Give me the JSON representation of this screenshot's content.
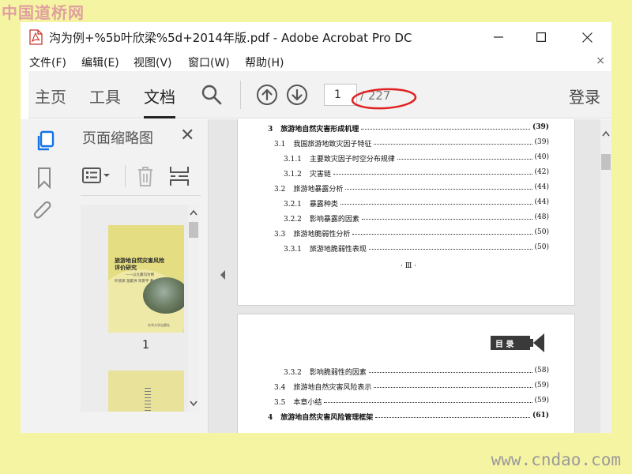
{
  "watermark_top": "中国道桥网",
  "watermark_bottom": "www.cndao.com",
  "window": {
    "title": "沟为例+%5b叶欣梁%5d+2014年版.pdf - Adobe Acrobat Pro DC"
  },
  "menu": {
    "items": [
      "文件(F)",
      "编辑(E)",
      "视图(V)",
      "窗口(W)",
      "帮助(H)"
    ],
    "close": "×"
  },
  "toolbar": {
    "tabs": [
      "主页",
      "工具",
      "文档"
    ],
    "active_tab": "文档",
    "page_current": "1",
    "page_total": "/ 227",
    "login": "登录"
  },
  "panel": {
    "title": "页面缩略图",
    "close": "✕",
    "thumb_label": "1",
    "cover_title_line1": "旅游地自然灾害风险",
    "cover_title_line2": "评价研究",
    "cover_subtitle": "——以九寨沟为例",
    "cover_authors": "叶欣梁  温家洪  邓贵平 著",
    "cover_publisher": "东华大学出版社"
  },
  "document": {
    "page1_lines": [
      {
        "num": "3",
        "text": "旅游地自然灾害形成机理",
        "page": "(39)",
        "level": 0
      },
      {
        "num": "3.1",
        "text": "我国旅游地致灾因子特征",
        "page": "(39)",
        "level": 1
      },
      {
        "num": "3.1.1",
        "text": "主要致灾因子时空分布规律",
        "page": "(40)",
        "level": 2
      },
      {
        "num": "3.1.2",
        "text": "灾害链",
        "page": "(42)",
        "level": 2
      },
      {
        "num": "3.2",
        "text": "旅游地暴露分析",
        "page": "(44)",
        "level": 1
      },
      {
        "num": "3.2.1",
        "text": "暴露种类",
        "page": "(44)",
        "level": 2
      },
      {
        "num": "3.2.2",
        "text": "影响暴露的因素",
        "page": "(48)",
        "level": 2
      },
      {
        "num": "3.3",
        "text": "旅游地脆弱性分析",
        "page": "(50)",
        "level": 1
      },
      {
        "num": "3.3.1",
        "text": "旅游地脆弱性表现",
        "page": "(50)",
        "level": 2
      }
    ],
    "page1_footer": "· Ⅲ ·",
    "page2_header": "目 录",
    "page2_lines": [
      {
        "num": "3.3.2",
        "text": "影响脆弱性的因素",
        "page": "(58)",
        "level": 2
      },
      {
        "num": "3.4",
        "text": "旅游地自然灾害风险表示",
        "page": "(59)",
        "level": 1
      },
      {
        "num": "3.5",
        "text": "本章小结",
        "page": "(59)",
        "level": 1
      },
      {
        "num": "4",
        "text": "旅游地自然灾害风险管理框架",
        "page": "(61)",
        "level": 0
      }
    ]
  },
  "colors": {
    "background": "#f5f4a2",
    "toolbar": "#f2f2f2",
    "accent_blue": "#1473e6",
    "annotation_red": "#e02020",
    "cover": "#e4dd82"
  }
}
